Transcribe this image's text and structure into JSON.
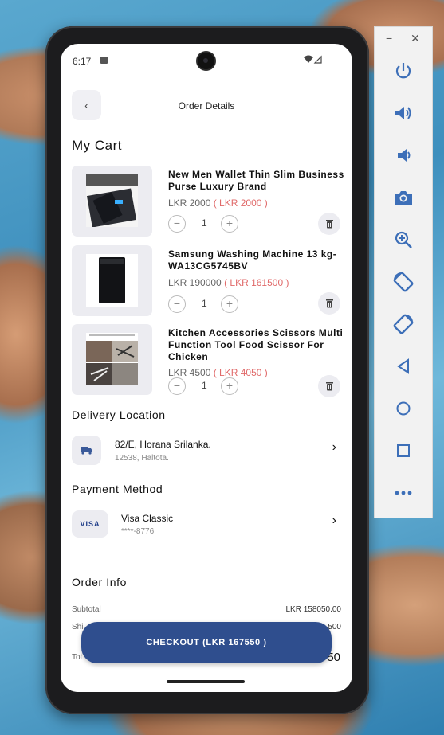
{
  "status": {
    "time": "6:17"
  },
  "header": {
    "title": "Order Details"
  },
  "cart": {
    "heading": "My Cart",
    "items": [
      {
        "title": "New Men Wallet Thin Slim Business Purse Luxury Brand",
        "price": "LKR 2000",
        "sale": "( LKR 2000 )",
        "qty": "1"
      },
      {
        "title": "Samsung Washing Machine 13 kg-WA13CG5745BV",
        "price": "LKR 190000",
        "sale": "( LKR 161500 )",
        "qty": "1"
      },
      {
        "title": "Kitchen Accessories Scissors Multi Function Tool Food Scissor For Chicken",
        "price": "LKR 4500",
        "sale": "( LKR 4050 )",
        "qty": "1"
      }
    ]
  },
  "delivery": {
    "heading": "Delivery Location",
    "address": "82/E, Horana Srilanka.",
    "detail": "12538, Haltota."
  },
  "payment": {
    "heading": "Payment Method",
    "badge": "VISA",
    "name": "Visa Classic",
    "number": "****-8776"
  },
  "order_info": {
    "heading": "Order Info",
    "subtotal_label": "Subtotal",
    "subtotal": "LKR 158050.00",
    "shipping_label_peek": "Shi",
    "shipping_peek": "500",
    "total_label_peek": "Tot",
    "total_peek": "50"
  },
  "checkout": {
    "label": "CHECKOUT (LKR 167550 )"
  },
  "emulator": {
    "minimize": "−",
    "close": "✕"
  }
}
